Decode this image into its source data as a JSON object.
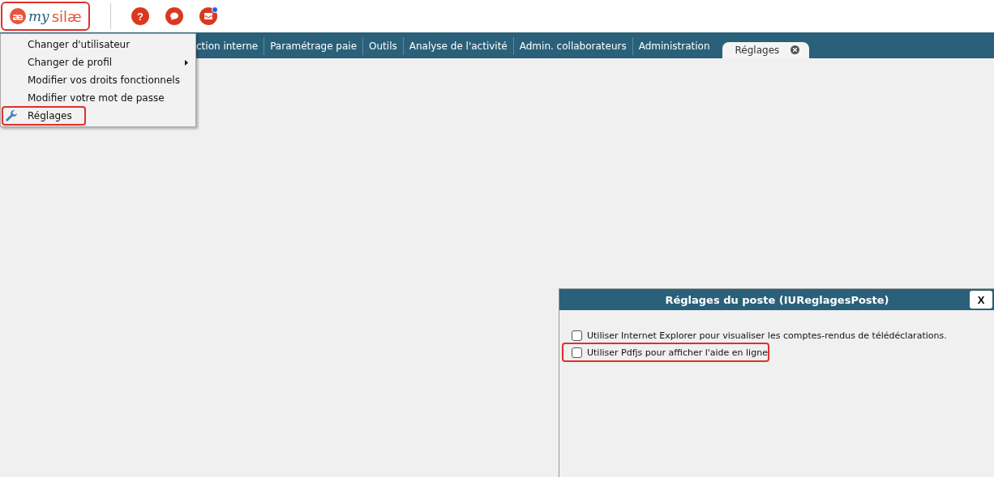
{
  "header": {
    "logo": {
      "mark": "æ",
      "word_1": "my",
      "word_2": "silæ",
      "highlighted": true
    },
    "icons": [
      {
        "kind": "help",
        "glyph": "?",
        "badge": false
      },
      {
        "kind": "chat",
        "badge": false
      },
      {
        "kind": "inbox",
        "badge": true
      }
    ]
  },
  "tabs": [
    {
      "label": "ction interne",
      "selected": false
    },
    {
      "label": "Paramétrage paie",
      "selected": false
    },
    {
      "label": "Outils",
      "selected": false
    },
    {
      "label": "Analyse de l'activité",
      "selected": false
    },
    {
      "label": "Admin. collaborateurs",
      "selected": false
    },
    {
      "label": "Administration",
      "selected": false
    },
    {
      "label": "Réglages",
      "selected": true
    }
  ],
  "menu": {
    "items": [
      {
        "label": "Changer d'utilisateur",
        "submenu": false,
        "kind": "plain",
        "highlighted": false
      },
      {
        "label": "Changer de profil",
        "submenu": true,
        "kind": "plain",
        "highlighted": false
      },
      {
        "label": "Modifier vos droits fonctionnels",
        "submenu": false,
        "kind": "plain",
        "highlighted": false
      },
      {
        "label": "Modifier votre mot de passe",
        "submenu": false,
        "kind": "plain",
        "highlighted": false
      },
      {
        "label": "Réglages",
        "submenu": false,
        "kind": "settings",
        "highlighted": true
      }
    ]
  },
  "dialog": {
    "title": "Réglages du poste (IUReglagesPoste)",
    "close": "X",
    "options": [
      {
        "label": "Utiliser Internet Explorer pour visualiser les comptes-rendus de télédéclarations.",
        "checked": false,
        "highlighted": false
      },
      {
        "label": "Utiliser Pdfjs pour afficher l'aide en ligne",
        "checked": false,
        "highlighted": true
      }
    ]
  }
}
